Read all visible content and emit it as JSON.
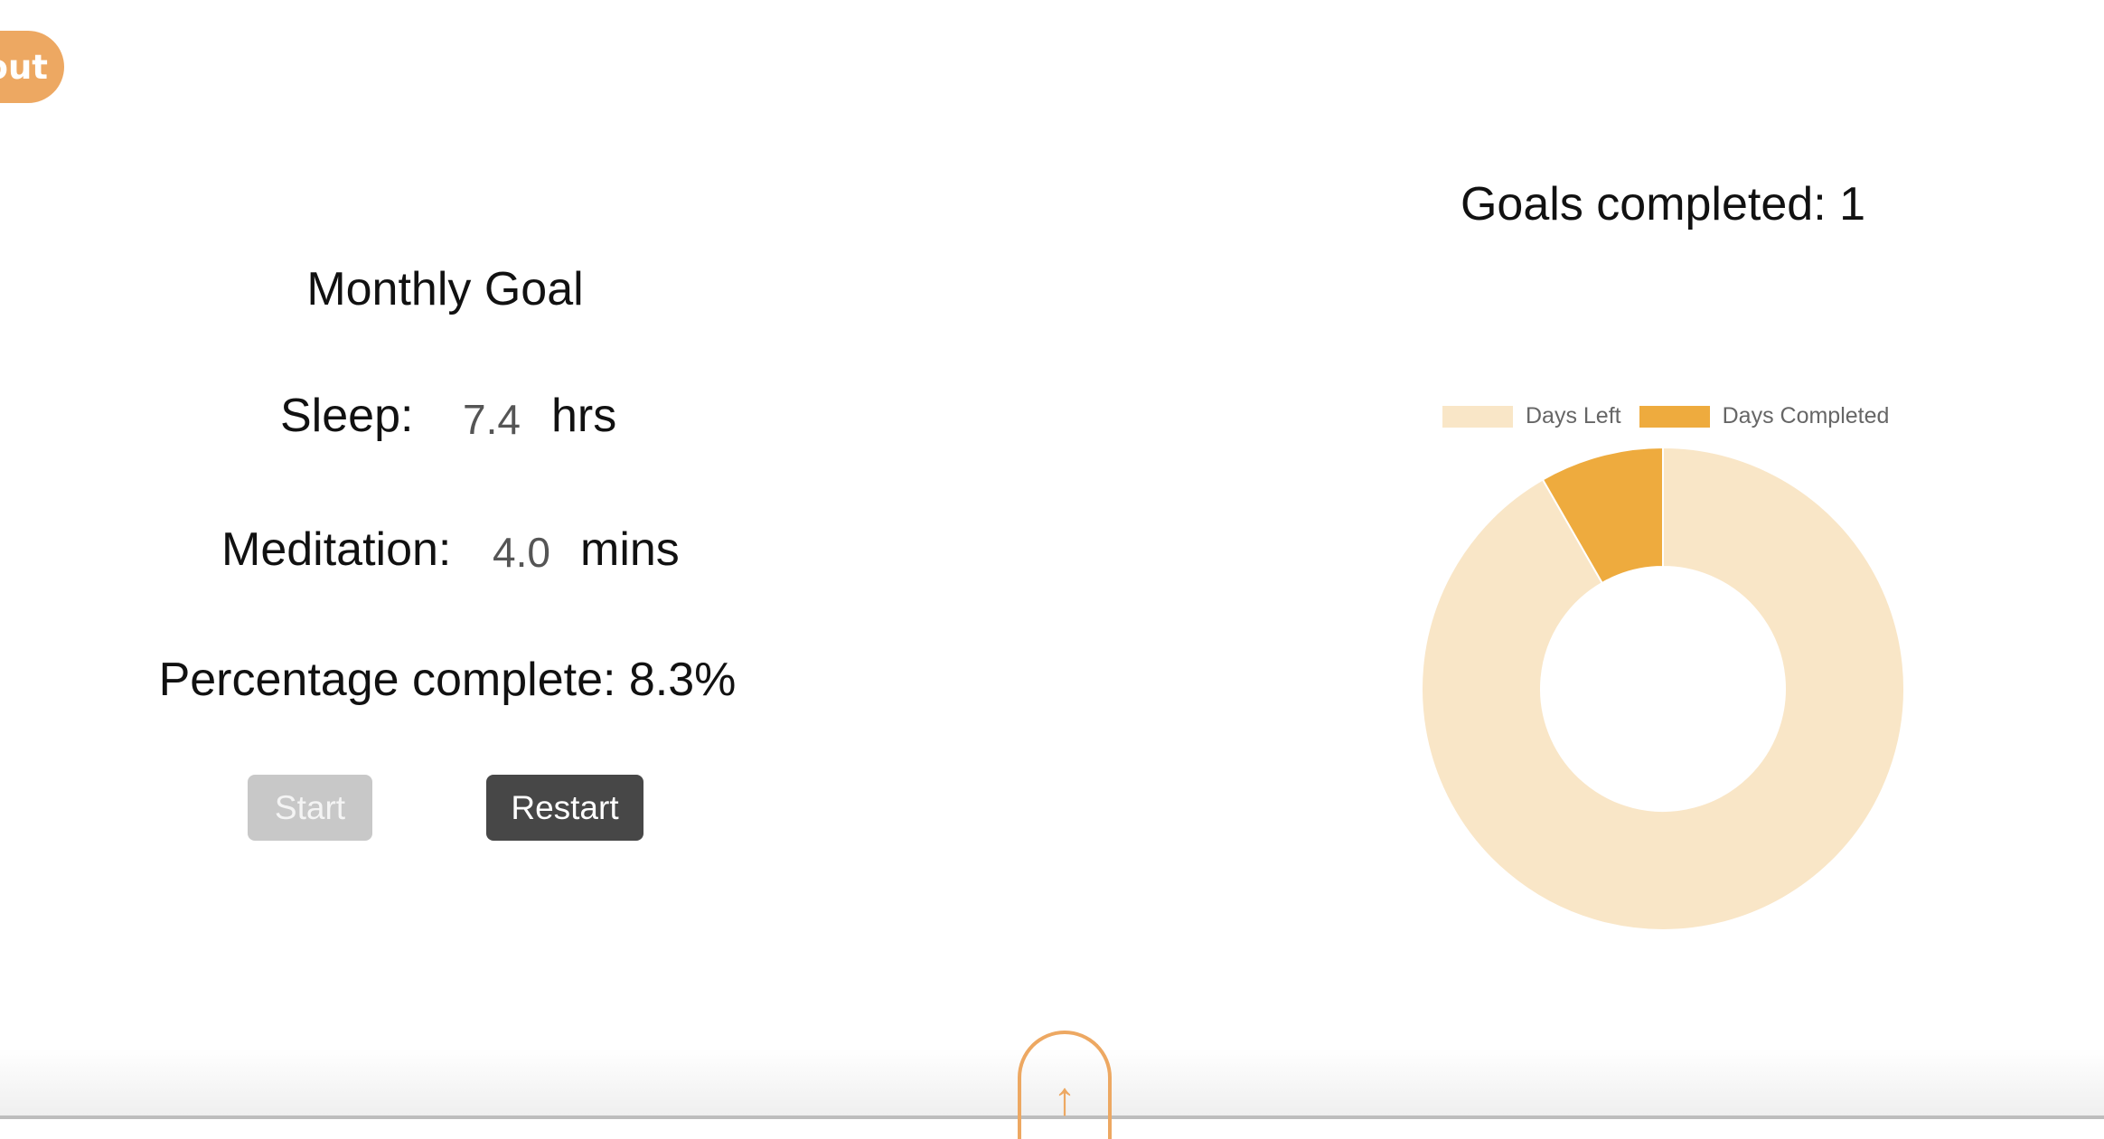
{
  "nav": {
    "logout_label": "out"
  },
  "goal": {
    "title": "Monthly Goal",
    "sleep": {
      "label": "Sleep:",
      "value": "7.4",
      "unit": "hrs"
    },
    "meditation": {
      "label": "Meditation:",
      "value": "4.0",
      "unit": "mins"
    },
    "percentage_label": "Percentage complete: 8.3%",
    "start_label": "Start",
    "restart_label": "Restart"
  },
  "stats": {
    "goals_completed": "Goals completed: 1"
  },
  "chart_data": {
    "type": "doughnut",
    "labels": [
      "Days Left",
      "Days Completed"
    ],
    "values": [
      91.7,
      8.3
    ],
    "colors": [
      "#f9e6c7",
      "#eeab3e"
    ],
    "legend": "top"
  },
  "footer": {
    "scroll_top_icon": "↑"
  }
}
